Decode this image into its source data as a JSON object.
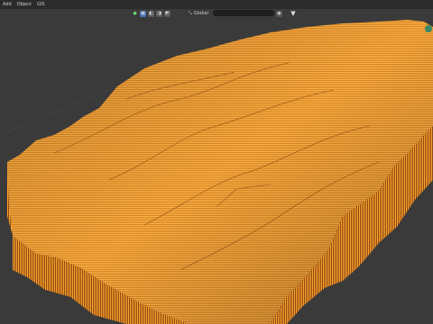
{
  "menubar": {
    "items": [
      {
        "label": "Add"
      },
      {
        "label": "Object"
      },
      {
        "label": "GIS"
      }
    ]
  },
  "viewport_header": {
    "mode_icons": [
      "snap-toggle-icon",
      "select-box-icon",
      "vertex-select-icon",
      "edge-select-icon",
      "face-select-icon"
    ],
    "orientation_label": "Global",
    "shading_icons": [
      "eye-visibility-icon",
      "filter-icon"
    ]
  },
  "scene": {
    "description_hidden": "",
    "terrain_color": "#ffa32e",
    "terrain_shadow": "#b8661a",
    "background_color": "#3a3a3a"
  }
}
